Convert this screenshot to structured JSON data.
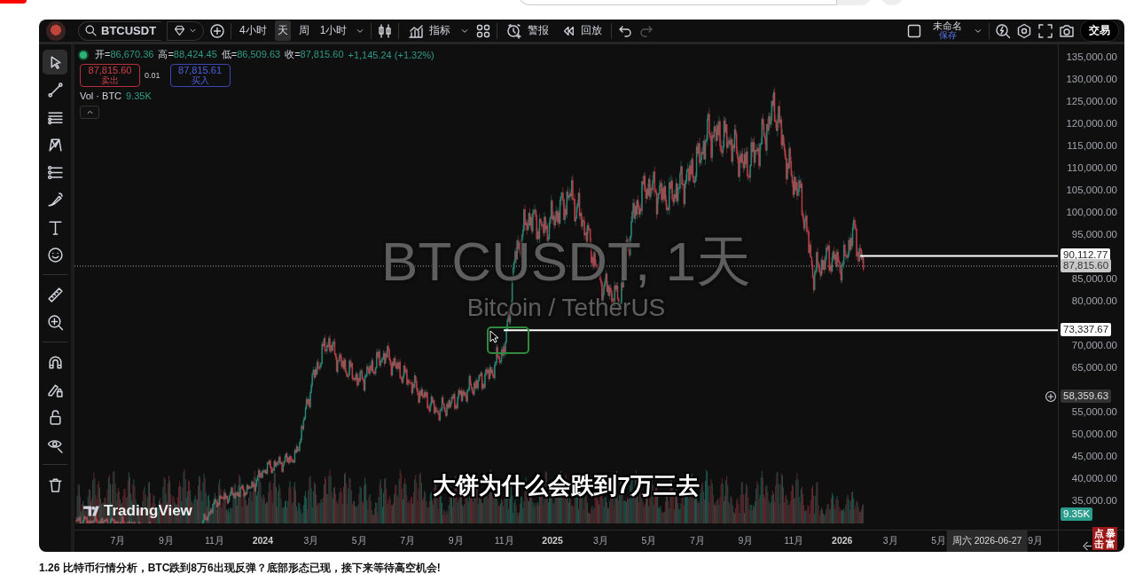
{
  "toolbar": {
    "symbol": "BTCUSDT",
    "intervals": [
      {
        "label": "4小时",
        "selected": false
      },
      {
        "label": "天",
        "selected": true
      },
      {
        "label": "周",
        "selected": false
      },
      {
        "label": "1小时",
        "selected": false
      }
    ],
    "indicators": "指标",
    "alert": "警报",
    "replay": "回放",
    "layout_name": "未命名",
    "save": "保存",
    "trade": "交易"
  },
  "drawing_tools": [
    {
      "kind": "cursor",
      "selected": true
    },
    {
      "kind": "trendline",
      "selected": false
    },
    {
      "kind": "lines",
      "selected": false
    },
    {
      "kind": "pattern",
      "selected": false
    },
    {
      "kind": "measure",
      "selected": false
    },
    {
      "kind": "brush",
      "selected": false
    },
    {
      "kind": "text",
      "selected": false
    },
    {
      "kind": "emoji",
      "selected": false
    },
    {
      "kind": "ruler",
      "selected": false
    },
    {
      "kind": "zoom",
      "selected": false
    },
    {
      "kind": "magnet",
      "selected": false
    },
    {
      "kind": "lockdraw",
      "selected": false
    },
    {
      "kind": "lock",
      "selected": false
    },
    {
      "kind": "eye",
      "selected": false
    },
    {
      "kind": "trash",
      "selected": false
    }
  ],
  "legend": {
    "ohlc": [
      {
        "label": "开=",
        "value": "86,670.36"
      },
      {
        "label": "高=",
        "value": "88,424.45"
      },
      {
        "label": "低=",
        "value": "86,509.63"
      },
      {
        "label": "收=",
        "value": "87,815.60"
      }
    ],
    "change": "+1,145.24 (+1.32%)",
    "sell": {
      "price": "87,815.60",
      "label": "卖出"
    },
    "spread": "0.01",
    "buy": {
      "price": "87,815.61",
      "label": "买入"
    },
    "volume": {
      "label": "Vol · BTC",
      "value": "9.35K"
    }
  },
  "watermark": {
    "title": "BTCUSDT, 1天",
    "subtitle": "Bitcoin / TetherUS"
  },
  "logo": "TradingView",
  "price_axis": [
    "135,000.00",
    "130,000.00",
    "125,000.00",
    "120,000.00",
    "115,000.00",
    "110,000.00",
    "105,000.00",
    "100,000.00",
    "95,000.00",
    "85,000.00",
    "80,000.00",
    "70,000.00",
    "65,000.00",
    "55,000.00",
    "50,000.00",
    "45,000.00",
    "40,000.00",
    "35,000.00"
  ],
  "price_labels": [
    {
      "kind": "line",
      "value": "90,112.77"
    },
    {
      "kind": "last",
      "value": "87,815.60"
    },
    {
      "kind": "line",
      "value": "73,337.67"
    },
    {
      "kind": "crosshair",
      "value": "58,359.63"
    },
    {
      "kind": "volume",
      "value": "9.35K"
    }
  ],
  "time_axis": [
    {
      "label": "7月",
      "year": false
    },
    {
      "label": "9月",
      "year": false
    },
    {
      "label": "11月",
      "year": false
    },
    {
      "label": "2024",
      "year": true
    },
    {
      "label": "3月",
      "year": false
    },
    {
      "label": "5月",
      "year": false
    },
    {
      "label": "7月",
      "year": false
    },
    {
      "label": "9月",
      "year": false
    },
    {
      "label": "11月",
      "year": false
    },
    {
      "label": "2025",
      "year": true
    },
    {
      "label": "3月",
      "year": false
    },
    {
      "label": "5月",
      "year": false
    },
    {
      "label": "7月",
      "year": false
    },
    {
      "label": "9月",
      "year": false
    },
    {
      "label": "11月",
      "year": false
    },
    {
      "label": "2026",
      "year": true
    },
    {
      "label": "3月",
      "year": false
    },
    {
      "label": "5月",
      "year": false
    },
    {
      "label": "周六 2026-06-27",
      "kind": "crosshair"
    },
    {
      "label": "9月",
      "year": false
    }
  ],
  "caption": "大饼为什么会跌到7万三去",
  "promo_badge": [
    "点击",
    "暴富"
  ],
  "video_title": "1.26 比特币行情分析，BTC跌到8万6出现反弹？底部形态已现，接下来等待高空机会!"
}
